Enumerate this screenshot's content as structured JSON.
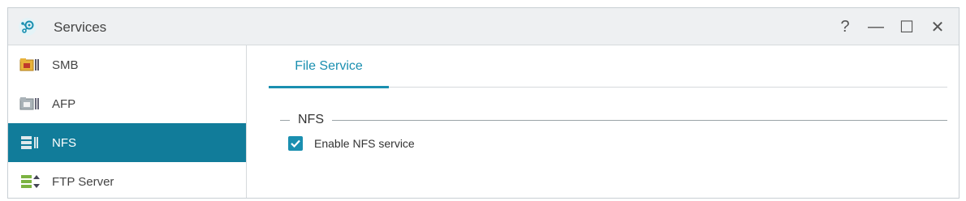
{
  "window": {
    "title": "Services",
    "controls": {
      "help": "?",
      "minimize": "—",
      "maximize": "☐",
      "close": "✕"
    }
  },
  "sidebar": {
    "items": [
      {
        "label": "SMB",
        "icon": "smb-folder-icon",
        "active": false
      },
      {
        "label": "AFP",
        "icon": "afp-folder-icon",
        "active": false
      },
      {
        "label": "NFS",
        "icon": "nfs-server-icon",
        "active": true
      },
      {
        "label": "FTP Server",
        "icon": "ftp-server-icon",
        "active": false
      }
    ]
  },
  "main": {
    "tabs": [
      {
        "label": "File Service",
        "active": true
      }
    ],
    "section": {
      "legend": "NFS",
      "checkbox": {
        "label": "Enable NFS service",
        "checked": true
      }
    }
  },
  "colors": {
    "accent": "#1a8fb0",
    "sidebar_active": "#117c9a",
    "titlebar_bg": "#eef0f2"
  }
}
